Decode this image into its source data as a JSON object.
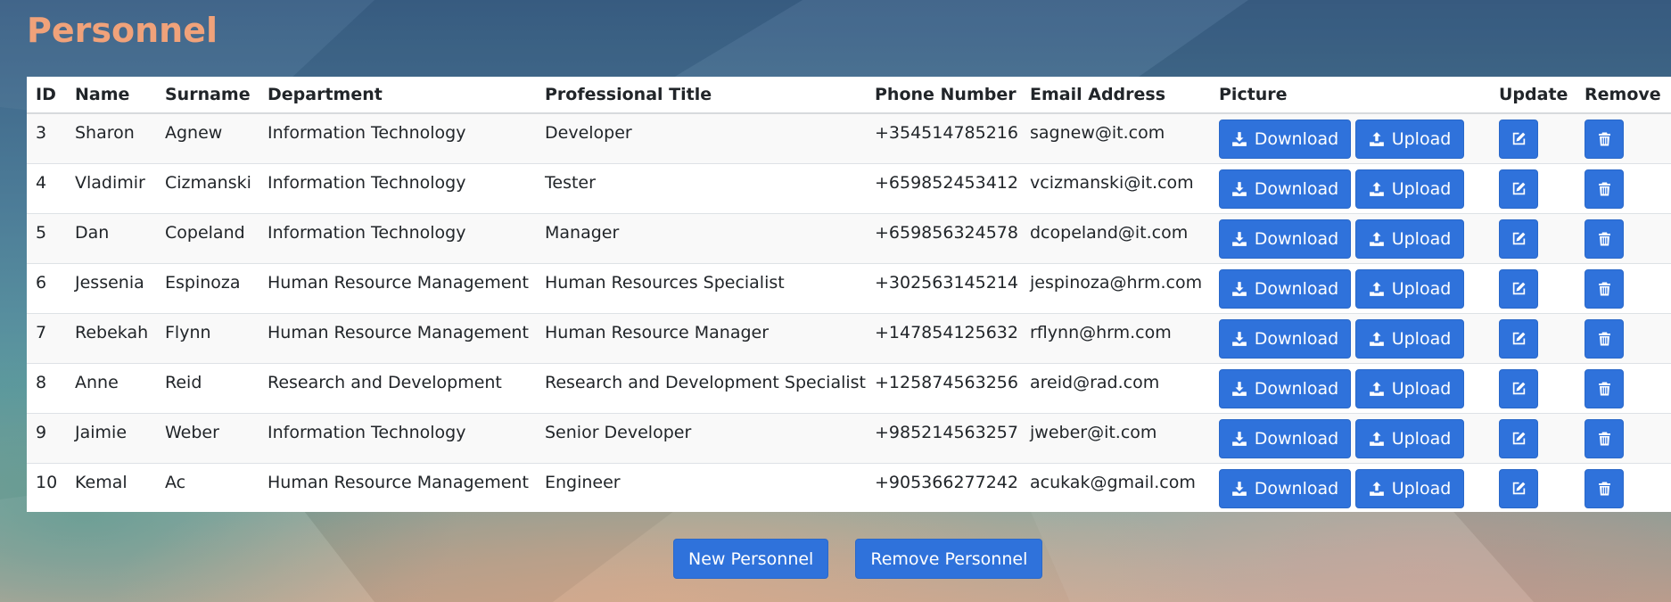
{
  "page": {
    "title": "Personnel"
  },
  "colors": {
    "title": "#f0a27a",
    "button": "#2f72db"
  },
  "table": {
    "columns": [
      "ID",
      "Name",
      "Surname",
      "Department",
      "Professional Title",
      "Phone Number",
      "Email Address",
      "Picture",
      "Update",
      "Remove"
    ],
    "row_actions": {
      "download_label": "Download",
      "upload_label": "Upload",
      "download_icon": "download-icon",
      "upload_icon": "upload-icon",
      "update_icon": "edit-icon",
      "remove_icon": "trash-icon"
    },
    "rows": [
      {
        "id": "3",
        "name": "Sharon",
        "surname": "Agnew",
        "department": "Information Technology",
        "title": "Developer",
        "phone": "+354514785216",
        "email": "sagnew@it.com"
      },
      {
        "id": "4",
        "name": "Vladimir",
        "surname": "Cizmanski",
        "department": "Information Technology",
        "title": "Tester",
        "phone": "+659852453412",
        "email": "vcizmanski@it.com"
      },
      {
        "id": "5",
        "name": "Dan",
        "surname": "Copeland",
        "department": "Information Technology",
        "title": "Manager",
        "phone": "+659856324578",
        "email": "dcopeland@it.com"
      },
      {
        "id": "6",
        "name": "Jessenia",
        "surname": "Espinoza",
        "department": "Human Resource Management",
        "title": "Human Resources Specialist",
        "phone": "+302563145214",
        "email": "jespinoza@hrm.com"
      },
      {
        "id": "7",
        "name": "Rebekah",
        "surname": "Flynn",
        "department": "Human Resource Management",
        "title": "Human Resource Manager",
        "phone": "+147854125632",
        "email": "rflynn@hrm.com"
      },
      {
        "id": "8",
        "name": "Anne",
        "surname": "Reid",
        "department": "Research and Development",
        "title": "Research and Development Specialist",
        "phone": "+125874563256",
        "email": "areid@rad.com"
      },
      {
        "id": "9",
        "name": "Jaimie",
        "surname": "Weber",
        "department": "Information Technology",
        "title": "Senior Developer",
        "phone": "+985214563257",
        "email": "jweber@it.com"
      },
      {
        "id": "10",
        "name": "Kemal",
        "surname": "Ac",
        "department": "Human Resource Management",
        "title": "Engineer",
        "phone": "+905366277242",
        "email": "acukak@gmail.com"
      }
    ]
  },
  "footer": {
    "new_label": "New Personnel",
    "remove_label": "Remove Personnel"
  }
}
